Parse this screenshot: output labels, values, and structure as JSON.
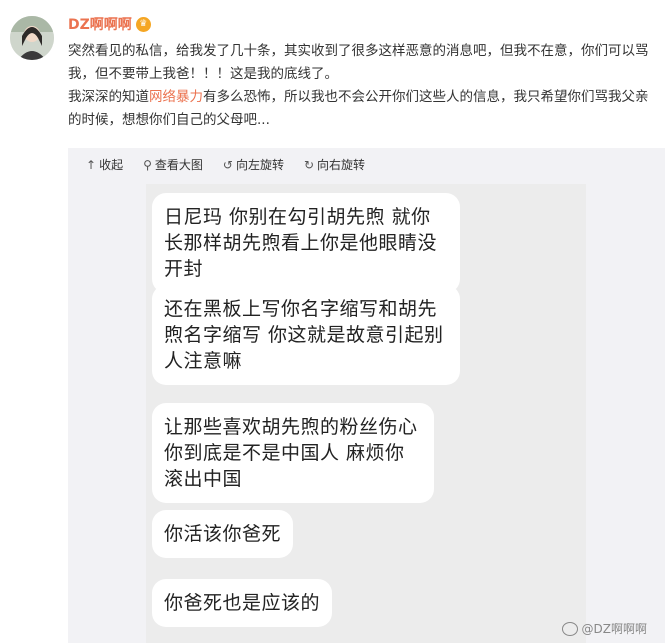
{
  "post": {
    "username": "DZ啊啊啊",
    "text_line1": "突然看见的私信，给我发了几十条，其实收到了很多这样恶意的消息吧，但我不在意，你们可以骂我，但不要带上我爸！！！这是我的底线了。",
    "text_line2_prefix": "我深深的知道",
    "text_line2_highlight": "网络暴力",
    "text_line2_suffix": "有多么恐怖，所以我也不会公开你们这些人的信息，我只希望你们骂我父亲的时候，想想你们自己的父母吧..."
  },
  "toolbar": {
    "collapse": "收起",
    "view_large": "查看大图",
    "rotate_left": "向左旋转",
    "rotate_right": "向右旋转"
  },
  "messages": [
    "日尼玛 你别在勾引胡先煦 就你长那样胡先煦看上你是他眼睛没开封",
    "还在黑板上写你名字缩写和胡先煦名字缩写 你这就是故意引起别人注意嘛",
    "让那些喜欢胡先煦的粉丝伤心 你到底是不是中国人 麻烦你滚出中国",
    "你活该你爸死",
    "你爸死也是应该的"
  ],
  "watermark": "@DZ啊啊啊"
}
